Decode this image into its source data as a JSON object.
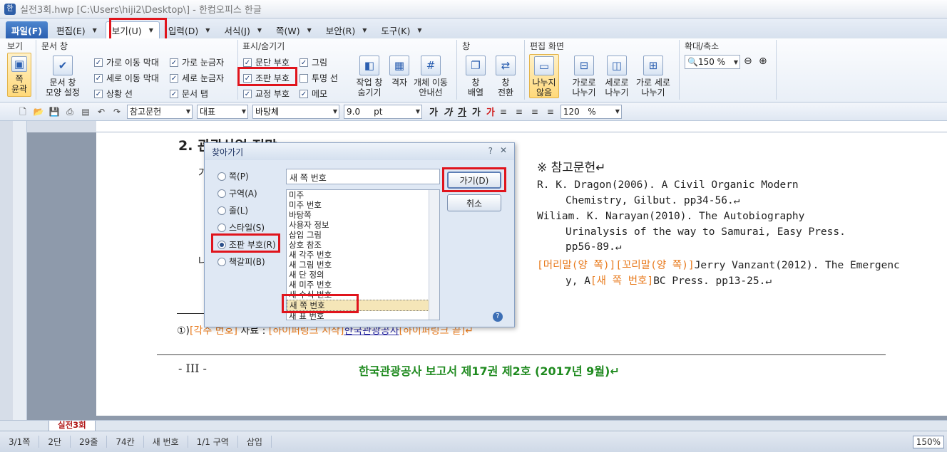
{
  "window": {
    "title": "실전3회.hwp [C:\\Users\\hiji2\\Desktop\\] - 한컴오피스 한글"
  },
  "menu": [
    "파일(F)",
    "편집(E)",
    "보기(U)",
    "입력(D)",
    "서식(J)",
    "쪽(W)",
    "보안(R)",
    "도구(K)"
  ],
  "ribbon": {
    "groups": [
      "보기",
      "문서 창",
      "표시/숨기기",
      "창",
      "편집 화면",
      "확대/축소"
    ],
    "view_btn": "쪽\n윤곽",
    "doc_window_btn": [
      "문서 창",
      "모양 설정"
    ],
    "checks": [
      {
        "label": "가로 이동 막대",
        "on": true
      },
      {
        "label": "가로 눈금자",
        "on": true
      },
      {
        "label": "세로 이동 막대",
        "on": true
      },
      {
        "label": "세로 눈금자",
        "on": true
      },
      {
        "label": "상황 선",
        "on": true
      },
      {
        "label": "문서 탭",
        "on": true
      },
      {
        "label": "문단 부호",
        "on": true
      },
      {
        "label": "그림",
        "on": true
      },
      {
        "label": "조판 부호",
        "on": true
      },
      {
        "label": "투명 선",
        "on": false
      },
      {
        "label": "교정 부호",
        "on": true
      },
      {
        "label": "메모",
        "on": true
      }
    ],
    "task_btn": "작업 창\n숨기기",
    "grid_btn": "격자",
    "object_btn": "개체 이동\n안내선",
    "arrange_btn": "창\n배열",
    "switch_btn": "창\n전환",
    "nosplit_btn": "나누지\n않음",
    "hsplit_btn": "가로로\n나누기",
    "vsplit_btn": "세로로\n나누기",
    "hvsplit_btn": "가로 세로\n나누기",
    "zoom": "150 %"
  },
  "toolbar": {
    "style": "참고문헌",
    "rep": "대표",
    "font": "바탕체",
    "size": "9.0",
    "unit": "pt",
    "spacing": "120",
    "spacing_unit": "%"
  },
  "document": {
    "heading": "2. 관광산업 전망",
    "ref_title": "※ 참고문헌↵",
    "ref1a": "R.  K.  Dragon(2006).  A  Civil  Organic  Modern",
    "ref1b": "Chemistry, Gilbut. pp34-56.↵",
    "ref2a": "Wiliam.  K.  Narayan(2010).  The  Autobiography",
    "ref2b": "Urinalysis of the way to Samurai, Easy Press.",
    "ref2c": "pp56-89.↵",
    "ref3a_tag": "[머리말(양 쪽)][꼬리말(양 쪽)]",
    "ref3a": "Jerry Vanzant(2012). The Emergenc",
    "ref3b_pre": "y, A",
    "ref3b_tag": "[새 쪽 번호]",
    "ref3b": "BC Press. pp13-25.↵",
    "footnote_no": "①)",
    "footnote_tag": "[각주 번호]",
    "footnote_text": "자료 :",
    "footnote_tag2": "[하이퍼링크 시작]",
    "footnote_link": "한국관광공사",
    "footnote_tag3": "[하이퍼링크 끝]↵",
    "footer_page": "- III -",
    "footer_title": "한국관광공사 보고서 제17권 제2호 (2017년 9월)↵",
    "side_letter_1": "가",
    "side_letter_2": "나"
  },
  "dialog": {
    "title": "찾아가기",
    "help": "?",
    "options": [
      {
        "label": "쪽(P)",
        "on": false
      },
      {
        "label": "구역(A)",
        "on": false
      },
      {
        "label": "줄(L)",
        "on": false
      },
      {
        "label": "스타일(S)",
        "on": false
      },
      {
        "label": "조판 부호(R)",
        "on": true
      },
      {
        "label": "책갈피(B)",
        "on": false
      }
    ],
    "input": "새 쪽 번호",
    "list": [
      "미주",
      "미주 번호",
      "바탕쪽",
      "사용자 정보",
      "삽입 그림",
      "상호 참조",
      "새 각주 번호",
      "새 그림 번호",
      "새 단 정의",
      "새 미주 번호",
      "새 수식 번호",
      "새 쪽 번호",
      "새 표 번호"
    ],
    "go": "가기(D)",
    "cancel": "취소"
  },
  "tabs": {
    "doc": "실전3회"
  },
  "status": [
    "3/1쪽",
    "2단",
    "29줄",
    "74칸",
    "새 번호",
    "1/1 구역",
    "삽입"
  ],
  "status_zoom": "150%"
}
